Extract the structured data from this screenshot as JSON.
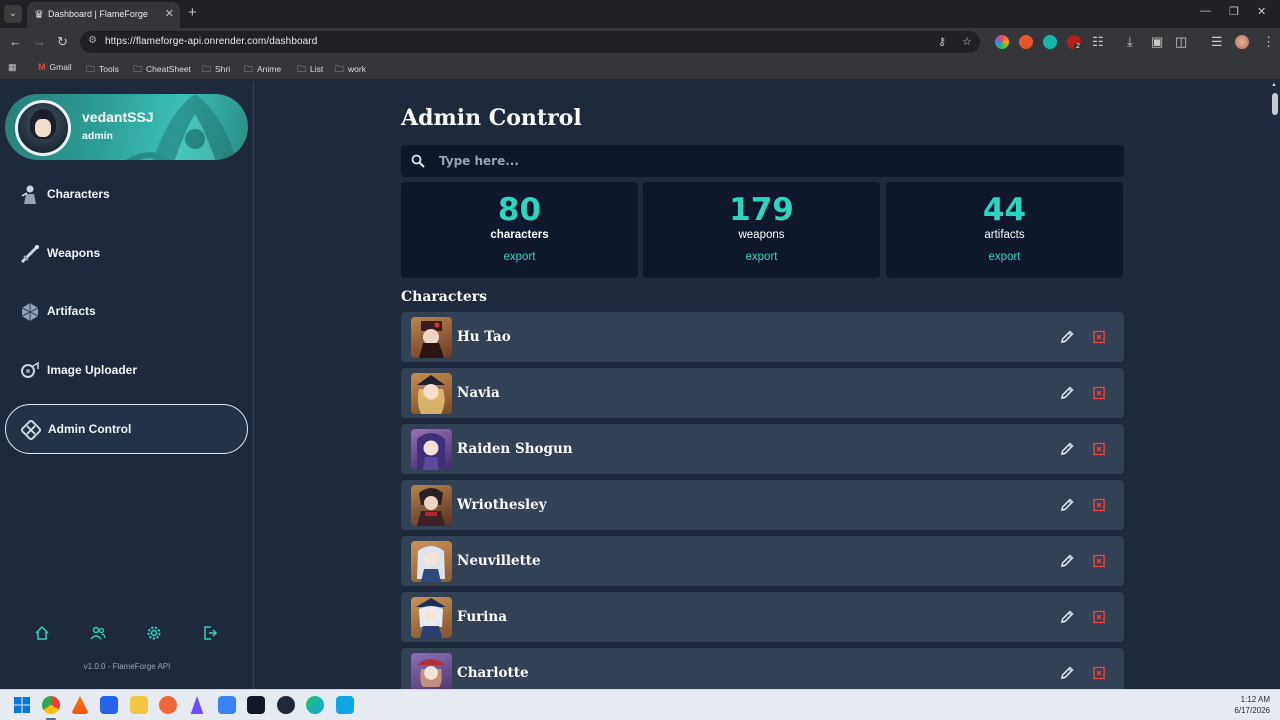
{
  "browser": {
    "tab_title": "Dashboard | FlameForge",
    "url": "https://flameforge-api.onrender.com/dashboard",
    "bookmarks": [
      "Gmail",
      "Tools",
      "CheatSheet",
      "Shri",
      "Anime",
      "List",
      "work"
    ],
    "extension_badge": "2"
  },
  "profile": {
    "username": "vedantSSJ",
    "role": "admin"
  },
  "sidebar": {
    "items": [
      {
        "label": "Characters",
        "icon": "characters-icon",
        "active": false
      },
      {
        "label": "Weapons",
        "icon": "weapons-icon",
        "active": false
      },
      {
        "label": "Artifacts",
        "icon": "artifacts-icon",
        "active": false
      },
      {
        "label": "Image Uploader",
        "icon": "image-uploader-icon",
        "active": false
      },
      {
        "label": "Admin Control",
        "icon": "admin-control-icon",
        "active": true
      }
    ],
    "footer_icons": [
      "home-icon",
      "users-icon",
      "settings-icon",
      "logout-icon"
    ],
    "version": "v1.0.0 - FlameForge API"
  },
  "main": {
    "title": "Admin Control",
    "search_placeholder": "Type here...",
    "stats": [
      {
        "count": "80",
        "label": "characters",
        "export": "export"
      },
      {
        "count": "179",
        "label": "weapons",
        "export": "export"
      },
      {
        "count": "44",
        "label": "artifacts",
        "export": "export"
      }
    ],
    "section_title": "Characters",
    "characters": [
      {
        "name": "Hu Tao"
      },
      {
        "name": "Navia"
      },
      {
        "name": "Raiden Shogun"
      },
      {
        "name": "Wriothesley"
      },
      {
        "name": "Neuvillette"
      },
      {
        "name": "Furina"
      },
      {
        "name": "Charlotte"
      }
    ]
  },
  "colors": {
    "accent": "#2dd4bf",
    "background": "#1e293b",
    "panel": "#0f172a",
    "row": "#334155",
    "delete": "#ef4444"
  },
  "taskbar": {
    "time": "1:12 AM",
    "date": "6/17/2026"
  }
}
